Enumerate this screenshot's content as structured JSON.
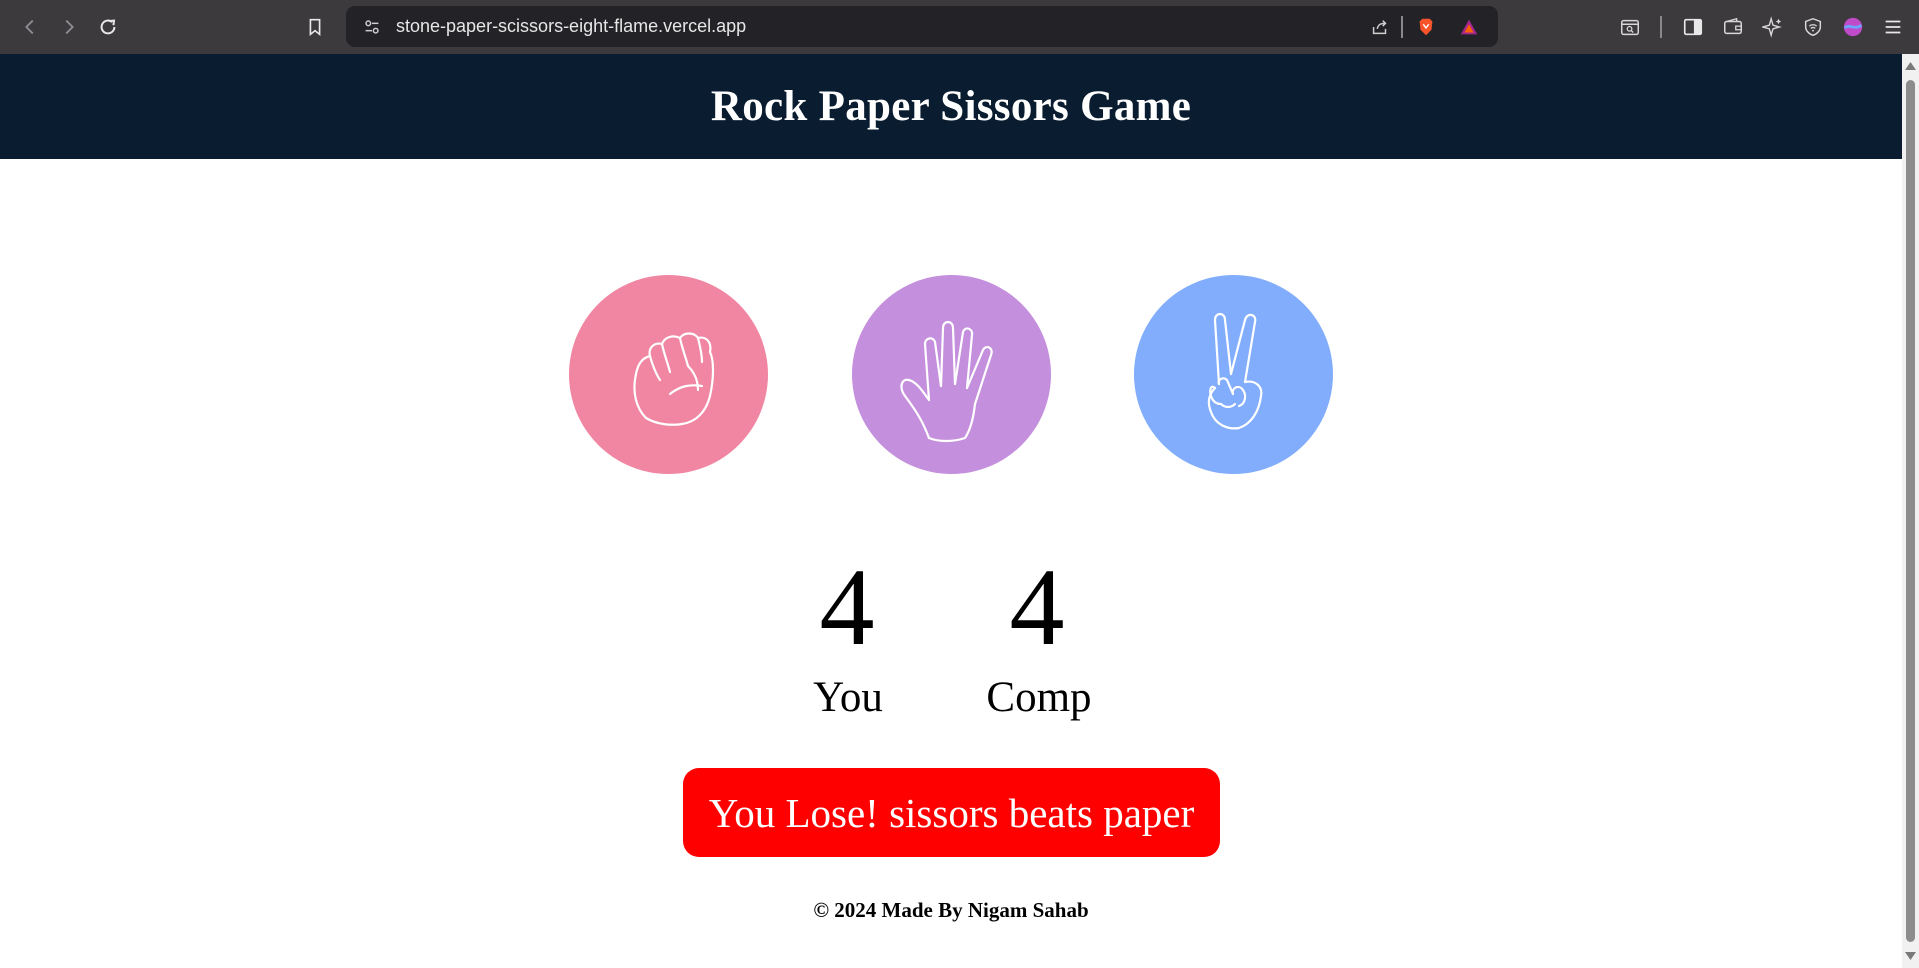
{
  "browser": {
    "url": "stone-paper-scissors-eight-flame.vercel.app"
  },
  "header": {
    "title": "Rock Paper Sissors Game"
  },
  "choices": [
    {
      "name": "rock",
      "color": "#f086a2",
      "icon": "fist-icon"
    },
    {
      "name": "paper",
      "color": "#c48fdd",
      "icon": "open-hand-icon"
    },
    {
      "name": "scissors",
      "color": "#82adfc",
      "icon": "victory-hand-icon"
    }
  ],
  "scoreboard": {
    "user_score": "4",
    "user_label": "You",
    "comp_score": "4",
    "comp_label": "Comp"
  },
  "message": {
    "text": "You Lose! sissors beats paper",
    "color": "#ff0000"
  },
  "footer": {
    "text": "© 2024 Made By Nigam Sahab"
  }
}
